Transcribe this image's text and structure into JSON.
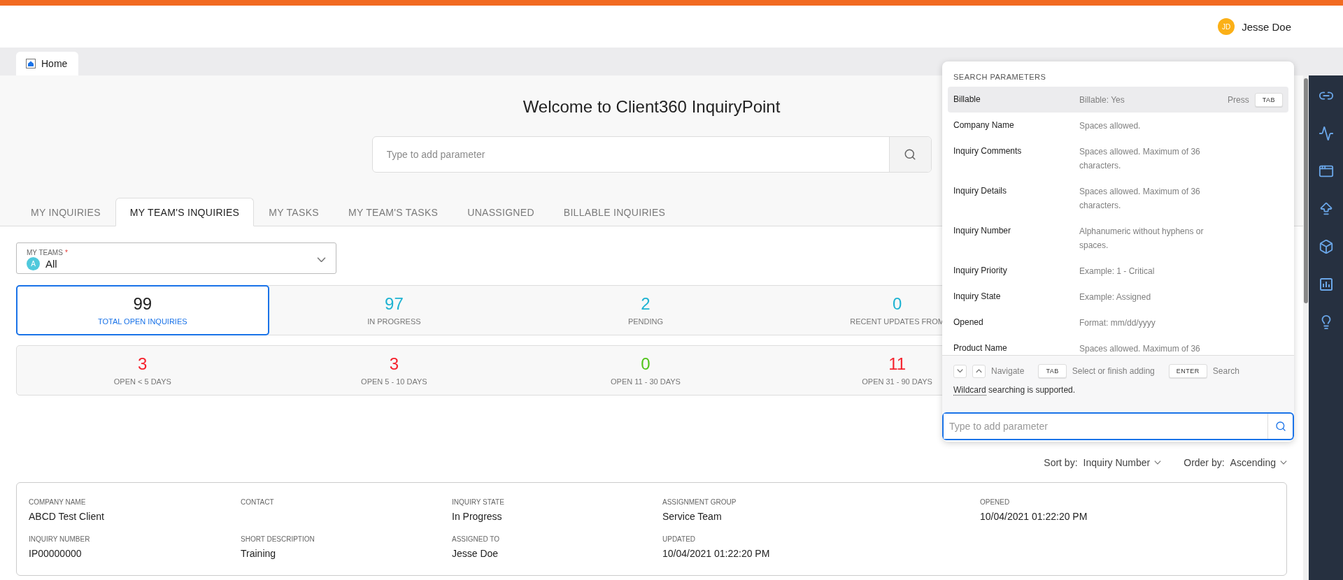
{
  "header": {
    "user": {
      "initials": "JD",
      "name": "Jesse Doe"
    }
  },
  "page_tabs": [
    {
      "label": "Home",
      "selected": true
    }
  ],
  "hero": {
    "title": "Welcome to Client360 InquiryPoint",
    "search": {
      "placeholder": "Type to add parameter"
    }
  },
  "tabs": [
    {
      "label": "MY INQUIRIES",
      "selected": false
    },
    {
      "label": "MY TEAM'S INQUIRIES",
      "selected": true
    },
    {
      "label": "MY TASKS",
      "selected": false
    },
    {
      "label": "MY TEAM'S TASKS",
      "selected": false
    },
    {
      "label": "UNASSIGNED",
      "selected": false
    },
    {
      "label": "BILLABLE INQUIRIES",
      "selected": false
    }
  ],
  "team_select": {
    "label": "MY TEAMS",
    "required_mark": "*",
    "avatar": "A",
    "value": "All"
  },
  "status_stats": [
    {
      "value": "99",
      "label": "TOTAL OPEN INQUIRIES",
      "color": "#222222",
      "selected": true
    },
    {
      "value": "97",
      "label": "IN PROGRESS",
      "color": "#1fb3d2",
      "selected": false
    },
    {
      "value": "2",
      "label": "PENDING",
      "color": "#1fb3d2",
      "selected": false
    },
    {
      "value": "0",
      "label": "RECENT UPDATES FROM",
      "color": "#1fb3d2",
      "selected": false
    }
  ],
  "age_stats": [
    {
      "value": "3",
      "label": "OPEN < 5 DAYS",
      "color": "#f5222d",
      "selected": false
    },
    {
      "value": "3",
      "label": "OPEN 5 - 10 DAYS",
      "color": "#f5222d",
      "selected": false
    },
    {
      "value": "0",
      "label": "OPEN 11 - 30 DAYS",
      "color": "#52c41a",
      "selected": false
    },
    {
      "value": "11",
      "label": "OPEN 31 - 90 DAYS",
      "color": "#f5222d",
      "selected": false
    }
  ],
  "sort": {
    "sort_label": "Sort by:",
    "sort_value": "Inquiry Number",
    "order_label": "Order by:",
    "order_value": "Ascending"
  },
  "inquiry_card": {
    "rows": [
      [
        {
          "label": "COMPANY NAME",
          "value": "ABCD Test Client"
        },
        {
          "label": "CONTACT"
        },
        {
          "label": "INQUIRY STATE",
          "value": "In Progress"
        },
        {
          "label": "ASSIGNMENT GROUP",
          "value": "Service Team"
        },
        {
          "label": "OPENED",
          "value": "10/04/2021 01:22:20 PM"
        }
      ],
      [
        {
          "label": "INQUIRY NUMBER",
          "value": "IP00000000"
        },
        {
          "label": "SHORT DESCRIPTION",
          "value": "Training"
        },
        {
          "label": "ASSIGNED TO",
          "value": "Jesse Doe"
        },
        {
          "label": "UPDATED",
          "value": "10/04/2021 01:22:20 PM"
        }
      ]
    ]
  },
  "search_panel": {
    "title": "SEARCH PARAMETERS",
    "selected_prompt": {
      "text": "Press",
      "key": "TAB"
    },
    "parameters": [
      {
        "name": "Billable",
        "hint": "Billable: Yes",
        "selected": true
      },
      {
        "name": "Company Name",
        "hint": "Spaces allowed.",
        "selected": false
      },
      {
        "name": "Inquiry Comments",
        "hint": "Spaces allowed. Maximum of 36 characters.",
        "selected": false
      },
      {
        "name": "Inquiry Details",
        "hint": "Spaces allowed. Maximum of 36 characters.",
        "selected": false
      },
      {
        "name": "Inquiry Number",
        "hint": "Alphanumeric without hyphens or spaces.",
        "selected": false
      },
      {
        "name": "Inquiry Priority",
        "hint": "Example: 1 - Critical",
        "selected": false
      },
      {
        "name": "Inquiry State",
        "hint": "Example: Assigned",
        "selected": false
      },
      {
        "name": "Opened",
        "hint": "Format: mm/dd/yyyy",
        "selected": false
      },
      {
        "name": "Product Name",
        "hint": "Spaces allowed. Maximum of 36",
        "selected": false
      }
    ],
    "shortcuts": [
      {
        "kind": "arrows",
        "label": "Navigate"
      },
      {
        "kind": "key",
        "key": "TAB",
        "label": "Select or finish adding"
      },
      {
        "kind": "key",
        "key": "ENTER",
        "label": "Search"
      }
    ],
    "note": {
      "link": "Wildcard",
      "text": "searching is supported."
    },
    "input": {
      "placeholder": "Type to add parameter"
    }
  }
}
